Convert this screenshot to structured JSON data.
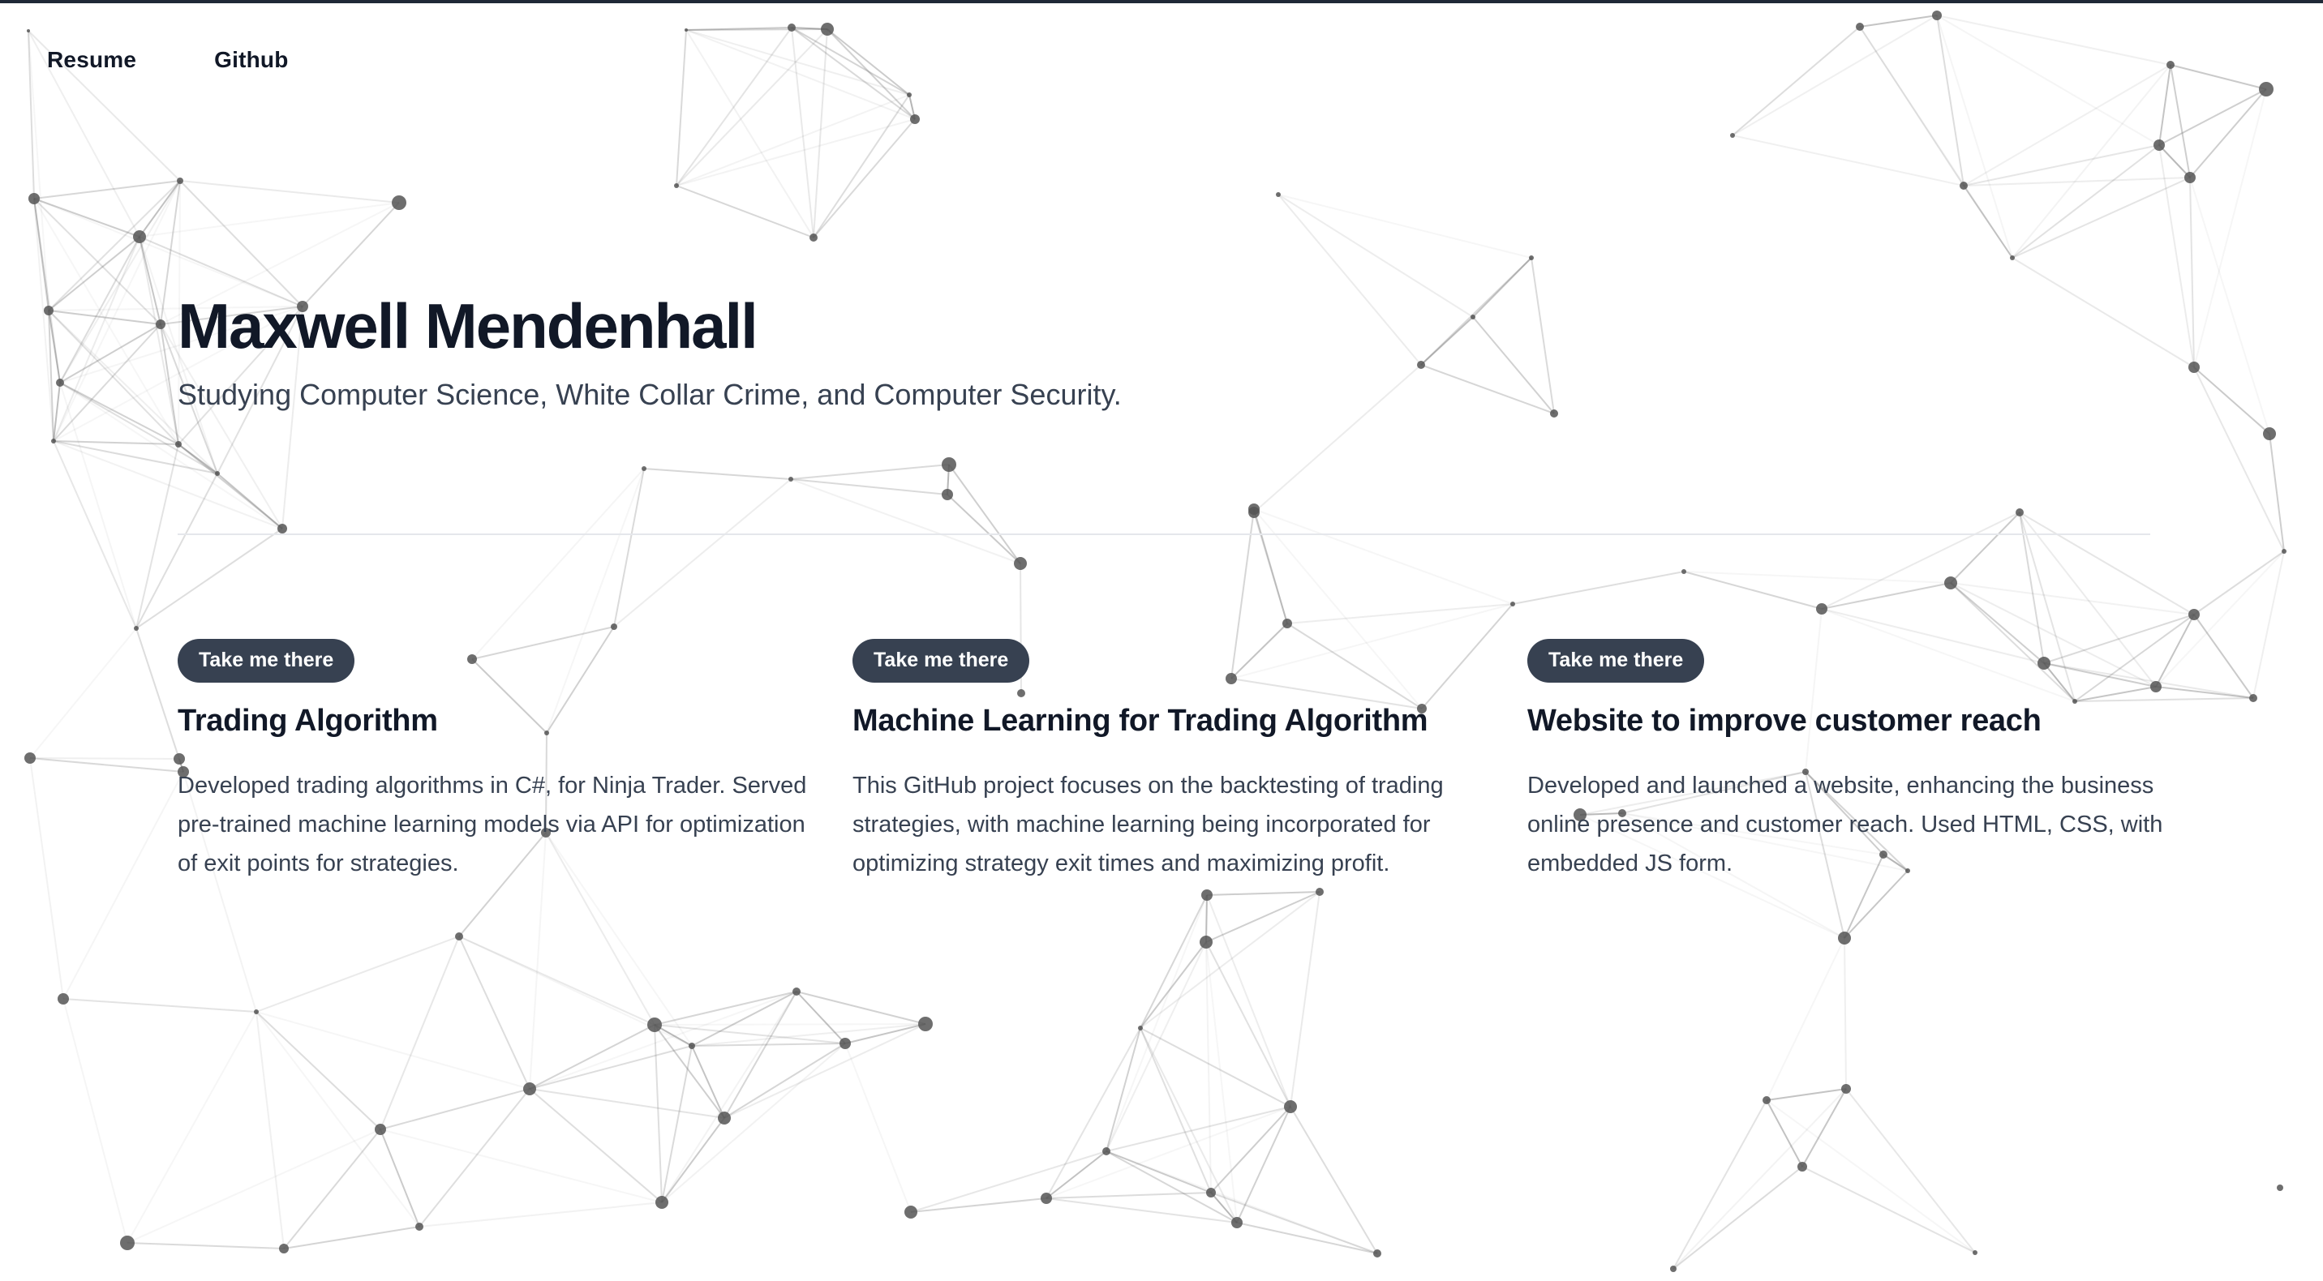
{
  "nav": {
    "items": [
      {
        "label": "Resume"
      },
      {
        "label": "Github"
      }
    ]
  },
  "hero": {
    "name": "Maxwell Mendenhall",
    "tagline": "Studying Computer Science, White Collar Crime, and Computer Security."
  },
  "projects": [
    {
      "button_label": "Take me there",
      "title": "Trading Algorithm",
      "description": "Developed trading algorithms in C#, for Ninja Trader. Served pre-trained machine learning models via API for optimization of exit points for strategies."
    },
    {
      "button_label": "Take me there",
      "title": "Machine Learning for Trading Algorithm",
      "description": "This GitHub project focuses on the backtesting of trading strategies, with machine learning being incorporated for optimizing strategy exit times and maximizing profit."
    },
    {
      "button_label": "Take me there",
      "title": "Website to improve customer reach",
      "description": "Developed and launched a website, enhancing the business online presence and customer reach. Used HTML, CSS, with embedded JS form."
    }
  ],
  "colors": {
    "accent_button": "#374151",
    "text_primary": "#111827",
    "text_secondary": "#374151",
    "network_node": "#555555"
  }
}
